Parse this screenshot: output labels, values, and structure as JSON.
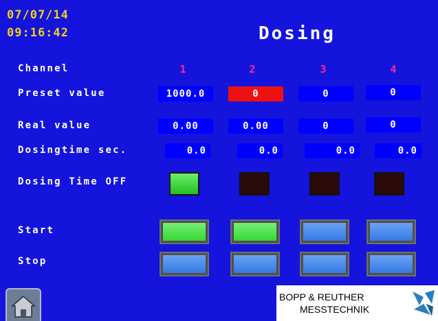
{
  "header": {
    "date": "07/07/14",
    "time": "09:16:42",
    "title": "Dosing"
  },
  "labels": {
    "channel": "Channel",
    "preset_value": "Preset value",
    "real_value": "Real value",
    "dosing_time": "Dosingtime sec.",
    "dosing_time_off": "Dosing Time OFF",
    "start": "Start",
    "stop": "Stop"
  },
  "channels": [
    {
      "number": "1",
      "preset": "1000.0",
      "real": "0.00",
      "dosing_time": "0.0",
      "dosing_time_off": true,
      "start_active": true,
      "stop_active": false
    },
    {
      "number": "2",
      "preset": "0",
      "real": "0.00",
      "dosing_time": "0.0",
      "dosing_time_off": false,
      "start_active": true,
      "stop_active": false
    },
    {
      "number": "3",
      "preset": "0",
      "real": "0",
      "dosing_time": "0.0",
      "dosing_time_off": false,
      "start_active": false,
      "stop_active": false
    },
    {
      "number": "4",
      "preset": "0",
      "real": "0",
      "dosing_time": "0.0",
      "dosing_time_off": false,
      "start_active": false,
      "stop_active": false
    }
  ],
  "logo": {
    "line1": "BOPP & REUTHER",
    "line2": "MESSTECHNIK"
  },
  "icons": {
    "home": "home-icon",
    "logo_mark": "bopp-reuther-logo-icon"
  },
  "colors": {
    "background": "#1414dc",
    "field": "#0000ff",
    "selected_field": "#ee1111",
    "clock": "#f0d020",
    "channel_number": "#ff2a8c",
    "active_green": "#2bd62b",
    "inactive_blue": "#2f74e0",
    "led_off": "#2a0a0a"
  }
}
